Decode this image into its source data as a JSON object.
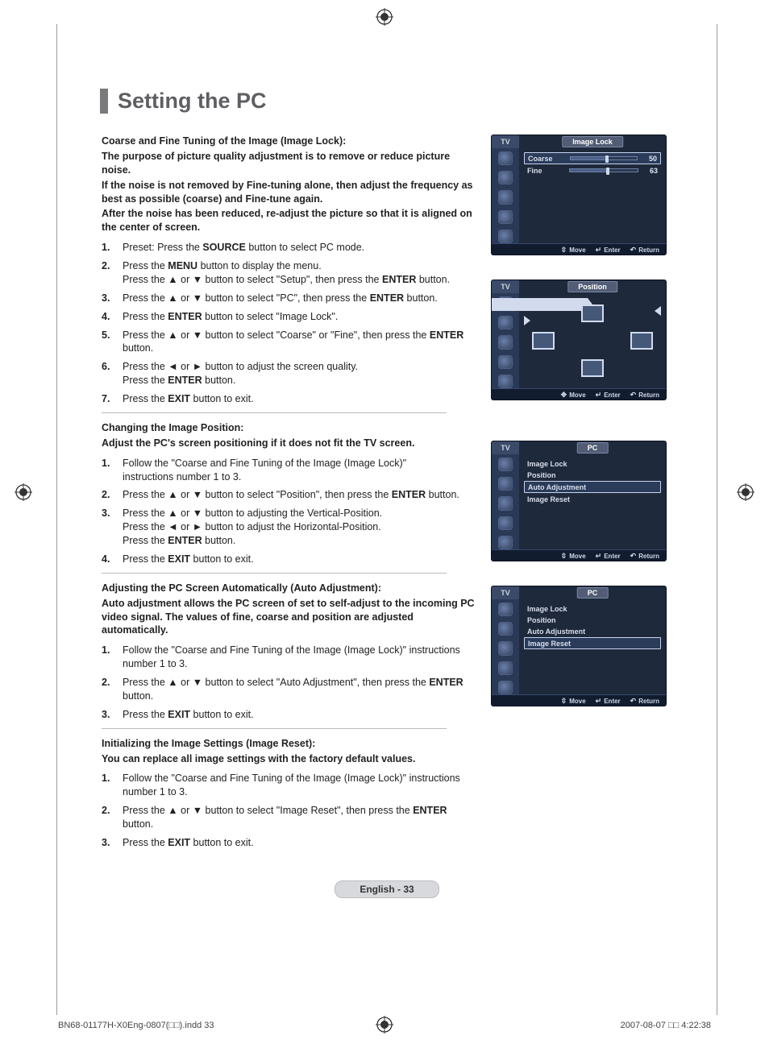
{
  "title": "Setting the PC",
  "sectionA": {
    "head1": "Coarse and Fine Tuning of the Image (Image Lock):",
    "head2": "The purpose of picture quality adjustment is to remove or reduce picture noise.",
    "head3": "If the noise is not removed by Fine-tuning alone, then adjust the frequency as best as possible (coarse) and Fine-tune again.",
    "head4": "After the noise has been reduced, re-adjust the picture so that it is aligned on the center of screen.",
    "steps": [
      "Preset: Press the <b>SOURCE</b> button to select PC mode.",
      "Press the <b>MENU</b> button to display the menu.<br>Press the ▲ or ▼ button to select \"Setup\", then press the <b>ENTER</b> button.",
      "Press the ▲ or ▼ button to select \"PC\", then press the <b>ENTER</b> button.",
      "Press the <b>ENTER</b> button to select \"Image Lock\".",
      "Press the  ▲ or ▼ button to select \"Coarse\" or \"Fine\", then press the <b>ENTER</b> button.",
      "Press the ◄ or ► button to adjust the screen quality.<br>Press the <b>ENTER</b> button.",
      "Press the <b>EXIT</b> button to exit."
    ]
  },
  "sectionB": {
    "head1": "Changing the Image Position:",
    "head2": "Adjust the PC's screen positioning if it does not fit the TV screen.",
    "steps": [
      "Follow the \"Coarse and Fine Tuning of the Image (Image Lock)\"<br>instructions number 1 to 3.",
      "Press the ▲ or ▼ button to select \"Position\", then press the <b>ENTER</b> button.",
      "Press the ▲ or ▼ button to adjusting the Vertical-Position.<br>Press the ◄ or ► button to adjust the Horizontal-Position.<br>Press the <b>ENTER</b> button.",
      "Press the <b>EXIT</b> button to exit."
    ]
  },
  "sectionC": {
    "head1": "Adjusting the PC Screen Automatically (Auto Adjustment):",
    "head2": "Auto adjustment allows the PC screen of set to self-adjust to the incoming PC video signal. The values of fine, coarse and position are adjusted automatically.",
    "steps": [
      "Follow the \"Coarse and Fine Tuning of the Image (Image Lock)\" instructions number 1 to 3.",
      "Press the ▲ or ▼ button to select \"Auto Adjustment\", then press the <b>ENTER</b> button.",
      "Press the <b>EXIT</b> button to exit."
    ]
  },
  "sectionD": {
    "head1": "Initializing the Image Settings (Image Reset):",
    "head2": "You can replace all image settings with the factory default values.",
    "steps": [
      "Follow the \"Coarse and Fine Tuning of the Image (Image Lock)\"  instructions number 1 to 3.",
      "Press the ▲ or ▼ button to select \"Image Reset\", then press the <b>ENTER</b> button.",
      "Press the <b>EXIT</b> button to exit."
    ]
  },
  "osd": {
    "tv": "TV",
    "footer_move": "Move",
    "footer_enter": "Enter",
    "footer_return": "Return",
    "card1": {
      "title": "Image Lock",
      "coarse": "Coarse",
      "coarse_val": "50",
      "fine": "Fine",
      "fine_val": "63"
    },
    "card2": {
      "title": "Position"
    },
    "card3": {
      "title": "PC",
      "items": [
        "Image Lock",
        "Position",
        "Auto Adjustment",
        "Image Reset"
      ],
      "selected_index": 2
    },
    "card4": {
      "title": "PC",
      "items": [
        "Image Lock",
        "Position",
        "Auto Adjustment",
        "Image Reset"
      ],
      "selected_index": 3
    }
  },
  "page_label": "English - 33",
  "footer_left": "BN68-01177H-X0Eng-0807(□□).indd   33",
  "footer_right": "2007-08-07   □□ 4:22:38"
}
